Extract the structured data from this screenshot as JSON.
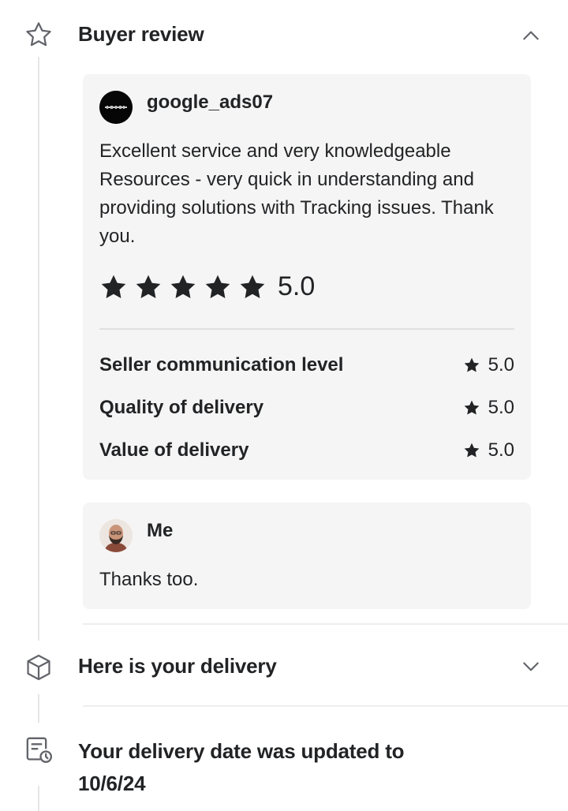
{
  "buyer_review": {
    "title": "Buyer review",
    "icon": "star-outline-icon",
    "expanded": true,
    "review": {
      "username": "google_ads07",
      "text": "Excellent service and very knowledgeable Resources - very quick in understanding and providing solutions with Tracking issues. Thank you.",
      "overall_score": "5.0",
      "stars": 5,
      "ratings": [
        {
          "label": "Seller communication level",
          "value": "5.0"
        },
        {
          "label": "Quality of delivery",
          "value": "5.0"
        },
        {
          "label": "Value of delivery",
          "value": "5.0"
        }
      ]
    },
    "reply": {
      "username": "Me",
      "text": "Thanks too."
    }
  },
  "delivery": {
    "title": "Here is your delivery",
    "icon": "package-icon",
    "expanded": false
  },
  "delivery_date": {
    "title_line1": "Your delivery date was updated to",
    "title_line2": "10/6/24",
    "icon": "calendar-clock-icon"
  },
  "colors": {
    "text": "#222325",
    "card_bg": "#f5f5f5",
    "timeline": "#e4e5e7"
  }
}
